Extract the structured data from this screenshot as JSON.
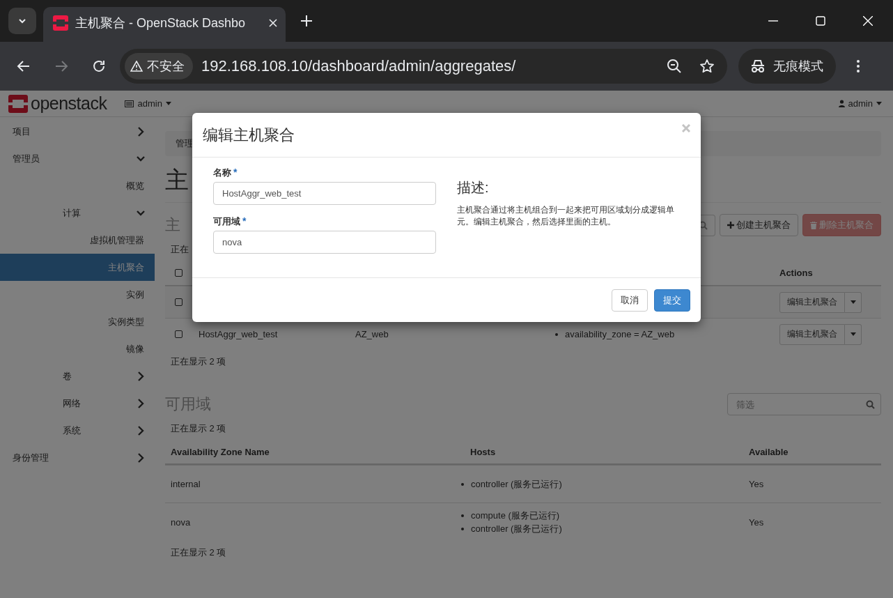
{
  "browser": {
    "tab_title": "主机聚合 - OpenStack Dashbo",
    "security": "不安全",
    "url": "192.168.108.10/dashboard/admin/aggregates/",
    "profile": "无痕模式"
  },
  "topbar": {
    "logo": "openstack",
    "project": "admin",
    "user": "admin"
  },
  "sidebar": {
    "items": [
      {
        "label": "项目",
        "expanded": false
      },
      {
        "label": "管理员",
        "expanded": true,
        "children": [
          {
            "label": "概览",
            "selected": false
          },
          {
            "label": "计算",
            "expanded": true,
            "children": [
              {
                "label": "虚拟机管理器",
                "selected": false
              },
              {
                "label": "主机聚合",
                "selected": true
              },
              {
                "label": "实例",
                "selected": false
              },
              {
                "label": "实例类型",
                "selected": false
              },
              {
                "label": "镜像",
                "selected": false
              }
            ]
          },
          {
            "label": "卷",
            "expanded": false
          },
          {
            "label": "网络",
            "expanded": false
          },
          {
            "label": "系统",
            "expanded": false
          }
        ]
      },
      {
        "label": "身份管理",
        "expanded": false
      }
    ]
  },
  "page": {
    "breadcrumb": "管理",
    "title": "主",
    "aggregates": {
      "heading": "主",
      "create_button": "创建主机聚合",
      "delete_button": {
        "label": "删除主机聚合",
        "disabled": true
      },
      "count_top": "正在",
      "header_checked": false,
      "actions_header": "Actions",
      "rows": [
        {
          "checked": false,
          "action": "编辑主机聚合"
        },
        {
          "checked": false,
          "name": "HostAggr_web_test",
          "zone": "AZ_web",
          "metadata": [
            "availability_zone = AZ_web"
          ],
          "action": "编辑主机聚合"
        }
      ],
      "count_bottom": "正在显示 2 项"
    },
    "zones": {
      "heading": "可用域",
      "filter_placeholder": "筛选",
      "count_top": "正在显示 2 项",
      "columns": [
        "Availability Zone Name",
        "Hosts",
        "Available"
      ],
      "rows": [
        {
          "name": "internal",
          "hosts": [
            "controller (服务已运行)"
          ],
          "available": "Yes"
        },
        {
          "name": "nova",
          "hosts": [
            "compute (服务已运行)",
            "controller (服务已运行)"
          ],
          "available": "Yes"
        }
      ],
      "count_bottom": "正在显示 2 项"
    }
  },
  "modal": {
    "title": "编辑主机聚合",
    "fields": [
      {
        "label": "名称",
        "required_mark": "*",
        "value": "HostAggr_web_test"
      },
      {
        "label": "可用域",
        "required_mark": "*",
        "value": "nova"
      }
    ],
    "description_heading": "描述:",
    "description": "主机聚合通过将主机组合到一起来把可用区域划分成逻辑单元。编辑主机聚合，然后选择里面的主机。",
    "cancel": "取消",
    "submit": "提交"
  }
}
